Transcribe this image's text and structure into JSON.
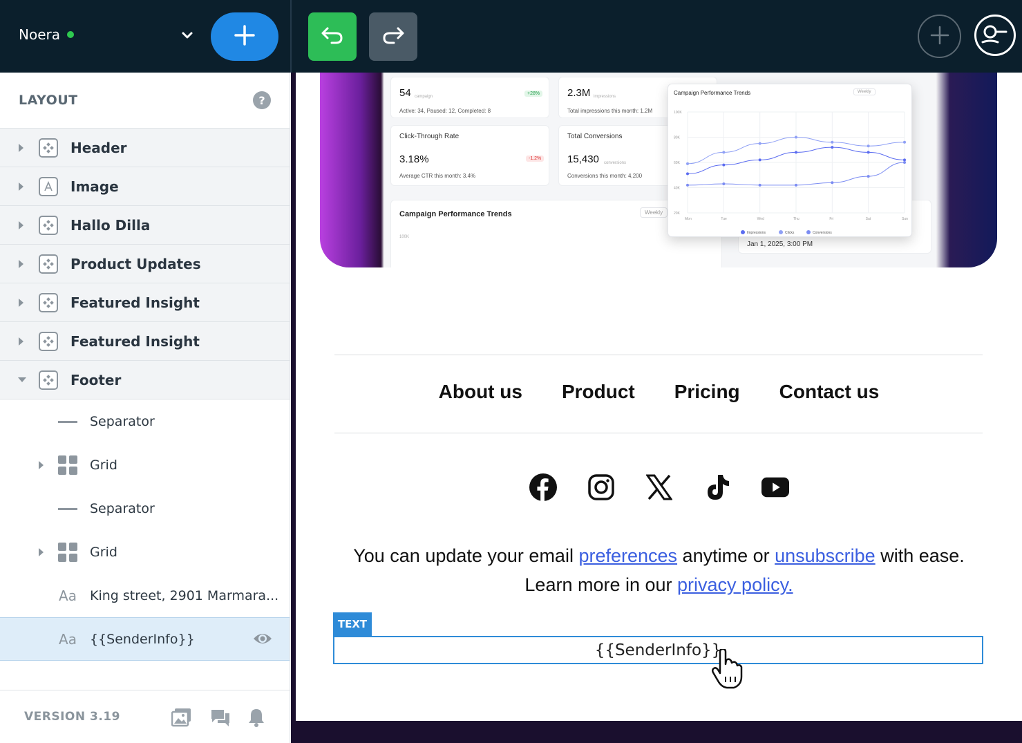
{
  "topbar": {
    "brand": "Noera",
    "status_color": "#2ec94f",
    "add_icon": "plus-icon",
    "undo_icon": "undo-icon",
    "redo_icon": "redo-icon",
    "accent": "#2088e4"
  },
  "sidebar": {
    "title": "LAYOUT",
    "help": "?",
    "sections": [
      {
        "label": "Header",
        "icon": "component-icon",
        "expanded": false
      },
      {
        "label": "Image",
        "icon": "text-block-icon",
        "expanded": false
      },
      {
        "label": "Hallo Dilla",
        "icon": "component-icon",
        "expanded": false
      },
      {
        "label": "Product Updates",
        "icon": "component-icon",
        "expanded": false
      },
      {
        "label": "Featured Insight",
        "icon": "component-icon",
        "expanded": false
      },
      {
        "label": "Featured Insight",
        "icon": "component-icon",
        "expanded": false
      },
      {
        "label": "Footer",
        "icon": "component-icon",
        "expanded": true
      }
    ],
    "footer_children": [
      {
        "label": "Separator",
        "icon": "separator-icon"
      },
      {
        "label": "Grid",
        "icon": "grid-icon"
      },
      {
        "label": "Separator",
        "icon": "separator-icon"
      },
      {
        "label": "Grid",
        "icon": "grid-icon"
      },
      {
        "label": "King street, 2901 Marmara...",
        "icon": "text-icon"
      },
      {
        "label": "{{SenderInfo}}",
        "icon": "text-icon",
        "selected": true
      }
    ],
    "version": "VERSION 3.19"
  },
  "dashboard": {
    "stat1_value": "54",
    "stat1_unit": "campaign",
    "stat1_badge": "+28%",
    "stat1_note": "Active: 34, Paused: 12, Completed: 8",
    "stat2_value": "2.3M",
    "stat2_unit": "impressions",
    "stat2_note": "Total impressions this month: 1.2M",
    "ctr_title": "Click-Through Rate",
    "ctr_value": "3.18%",
    "ctr_badge": "-1.2%",
    "ctr_note": "Average CTR this month: 3.4%",
    "conv_title": "Total Conversions",
    "conv_value": "15,430",
    "conv_unit": "conversions",
    "conv_note": "Conversions this month: 4,200",
    "trend_title": "Campaign Performance Trends",
    "trend_select": "Weekly",
    "trend_tick": "100K",
    "date_text": "Jan 1, 2025, 3:00 PM"
  },
  "popup_chart": {
    "title": "Campaign Performance Trends",
    "select": "Weekly",
    "y_ticks": [
      "100K",
      "80K",
      "60K",
      "40K",
      "20K"
    ],
    "x_ticks": [
      "Mon",
      "Tue",
      "Wed",
      "Thu",
      "Fri",
      "Sat",
      "Sun"
    ],
    "legend": [
      "Impressions",
      "Clicks",
      "Conversions"
    ]
  },
  "chart_data": {
    "type": "line",
    "title": "Campaign Performance Trends",
    "categories": [
      "Mon",
      "Tue",
      "Wed",
      "Thu",
      "Fri",
      "Sat",
      "Sun"
    ],
    "ylim": [
      20000,
      100000
    ],
    "series": [
      {
        "name": "Impressions",
        "values": [
          51000,
          58000,
          62000,
          68000,
          72000,
          68000,
          62000
        ],
        "color": "#5b6cf0"
      },
      {
        "name": "Clicks",
        "values": [
          59000,
          68000,
          75000,
          80000,
          76000,
          73000,
          76000
        ],
        "color": "#8fa0f5"
      },
      {
        "name": "Conversions",
        "values": [
          42000,
          43000,
          42000,
          42000,
          44000,
          49000,
          60000
        ],
        "color": "#7b8cf2"
      }
    ],
    "legend": "bottom"
  },
  "footer": {
    "links": [
      "About us",
      "Product",
      "Pricing",
      "Contact us"
    ],
    "socials": [
      "facebook-icon",
      "instagram-icon",
      "x-icon",
      "tiktok-icon",
      "youtube-icon"
    ],
    "notice_part1": "You can update your email ",
    "notice_link1": "preferences",
    "notice_part2": " anytime or ",
    "notice_link2": "unsubscribe",
    "notice_part3": " with ease.",
    "notice_part4": "Learn more in our ",
    "notice_link3": "privacy policy.",
    "text_tag": "TEXT",
    "sender": "{{SenderInfo}}"
  }
}
